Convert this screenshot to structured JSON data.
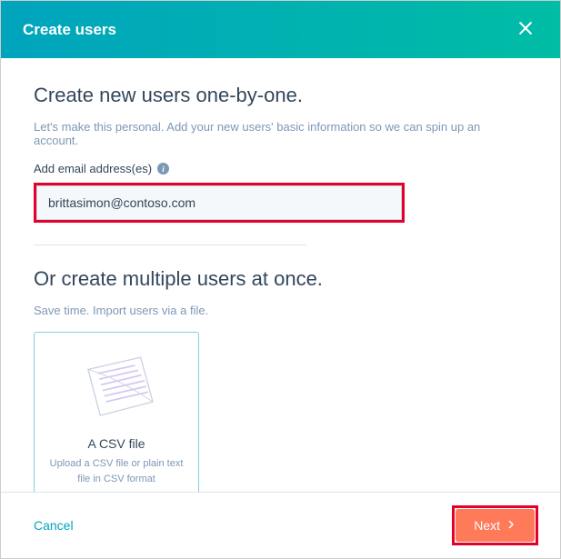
{
  "header": {
    "title": "Create users"
  },
  "section1": {
    "heading": "Create new users one-by-one.",
    "subtext": "Let's make this personal. Add your new users' basic information so we can spin up an account.",
    "field_label": "Add email address(es)",
    "email_value": "brittasimon@contoso.com"
  },
  "section2": {
    "heading": "Or create multiple users at once.",
    "subtext": "Save time. Import users via a file.",
    "csv_title": "A CSV file",
    "csv_desc": "Upload a CSV file or plain text file in CSV format"
  },
  "footer": {
    "cancel": "Cancel",
    "next": "Next"
  }
}
